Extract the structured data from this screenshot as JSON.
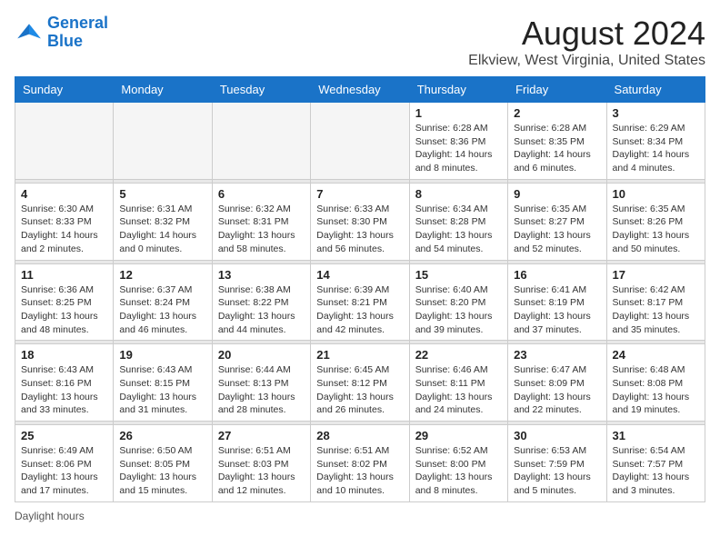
{
  "logo": {
    "line1": "General",
    "line2": "Blue"
  },
  "title": "August 2024",
  "subtitle": "Elkview, West Virginia, United States",
  "days_of_week": [
    "Sunday",
    "Monday",
    "Tuesday",
    "Wednesday",
    "Thursday",
    "Friday",
    "Saturday"
  ],
  "weeks": [
    [
      {
        "day": "",
        "info": ""
      },
      {
        "day": "",
        "info": ""
      },
      {
        "day": "",
        "info": ""
      },
      {
        "day": "",
        "info": ""
      },
      {
        "day": "1",
        "info": "Sunrise: 6:28 AM\nSunset: 8:36 PM\nDaylight: 14 hours and 8 minutes."
      },
      {
        "day": "2",
        "info": "Sunrise: 6:28 AM\nSunset: 8:35 PM\nDaylight: 14 hours and 6 minutes."
      },
      {
        "day": "3",
        "info": "Sunrise: 6:29 AM\nSunset: 8:34 PM\nDaylight: 14 hours and 4 minutes."
      }
    ],
    [
      {
        "day": "4",
        "info": "Sunrise: 6:30 AM\nSunset: 8:33 PM\nDaylight: 14 hours and 2 minutes."
      },
      {
        "day": "5",
        "info": "Sunrise: 6:31 AM\nSunset: 8:32 PM\nDaylight: 14 hours and 0 minutes."
      },
      {
        "day": "6",
        "info": "Sunrise: 6:32 AM\nSunset: 8:31 PM\nDaylight: 13 hours and 58 minutes."
      },
      {
        "day": "7",
        "info": "Sunrise: 6:33 AM\nSunset: 8:30 PM\nDaylight: 13 hours and 56 minutes."
      },
      {
        "day": "8",
        "info": "Sunrise: 6:34 AM\nSunset: 8:28 PM\nDaylight: 13 hours and 54 minutes."
      },
      {
        "day": "9",
        "info": "Sunrise: 6:35 AM\nSunset: 8:27 PM\nDaylight: 13 hours and 52 minutes."
      },
      {
        "day": "10",
        "info": "Sunrise: 6:35 AM\nSunset: 8:26 PM\nDaylight: 13 hours and 50 minutes."
      }
    ],
    [
      {
        "day": "11",
        "info": "Sunrise: 6:36 AM\nSunset: 8:25 PM\nDaylight: 13 hours and 48 minutes."
      },
      {
        "day": "12",
        "info": "Sunrise: 6:37 AM\nSunset: 8:24 PM\nDaylight: 13 hours and 46 minutes."
      },
      {
        "day": "13",
        "info": "Sunrise: 6:38 AM\nSunset: 8:22 PM\nDaylight: 13 hours and 44 minutes."
      },
      {
        "day": "14",
        "info": "Sunrise: 6:39 AM\nSunset: 8:21 PM\nDaylight: 13 hours and 42 minutes."
      },
      {
        "day": "15",
        "info": "Sunrise: 6:40 AM\nSunset: 8:20 PM\nDaylight: 13 hours and 39 minutes."
      },
      {
        "day": "16",
        "info": "Sunrise: 6:41 AM\nSunset: 8:19 PM\nDaylight: 13 hours and 37 minutes."
      },
      {
        "day": "17",
        "info": "Sunrise: 6:42 AM\nSunset: 8:17 PM\nDaylight: 13 hours and 35 minutes."
      }
    ],
    [
      {
        "day": "18",
        "info": "Sunrise: 6:43 AM\nSunset: 8:16 PM\nDaylight: 13 hours and 33 minutes."
      },
      {
        "day": "19",
        "info": "Sunrise: 6:43 AM\nSunset: 8:15 PM\nDaylight: 13 hours and 31 minutes."
      },
      {
        "day": "20",
        "info": "Sunrise: 6:44 AM\nSunset: 8:13 PM\nDaylight: 13 hours and 28 minutes."
      },
      {
        "day": "21",
        "info": "Sunrise: 6:45 AM\nSunset: 8:12 PM\nDaylight: 13 hours and 26 minutes."
      },
      {
        "day": "22",
        "info": "Sunrise: 6:46 AM\nSunset: 8:11 PM\nDaylight: 13 hours and 24 minutes."
      },
      {
        "day": "23",
        "info": "Sunrise: 6:47 AM\nSunset: 8:09 PM\nDaylight: 13 hours and 22 minutes."
      },
      {
        "day": "24",
        "info": "Sunrise: 6:48 AM\nSunset: 8:08 PM\nDaylight: 13 hours and 19 minutes."
      }
    ],
    [
      {
        "day": "25",
        "info": "Sunrise: 6:49 AM\nSunset: 8:06 PM\nDaylight: 13 hours and 17 minutes."
      },
      {
        "day": "26",
        "info": "Sunrise: 6:50 AM\nSunset: 8:05 PM\nDaylight: 13 hours and 15 minutes."
      },
      {
        "day": "27",
        "info": "Sunrise: 6:51 AM\nSunset: 8:03 PM\nDaylight: 13 hours and 12 minutes."
      },
      {
        "day": "28",
        "info": "Sunrise: 6:51 AM\nSunset: 8:02 PM\nDaylight: 13 hours and 10 minutes."
      },
      {
        "day": "29",
        "info": "Sunrise: 6:52 AM\nSunset: 8:00 PM\nDaylight: 13 hours and 8 minutes."
      },
      {
        "day": "30",
        "info": "Sunrise: 6:53 AM\nSunset: 7:59 PM\nDaylight: 13 hours and 5 minutes."
      },
      {
        "day": "31",
        "info": "Sunrise: 6:54 AM\nSunset: 7:57 PM\nDaylight: 13 hours and 3 minutes."
      }
    ]
  ],
  "footer": "Daylight hours"
}
